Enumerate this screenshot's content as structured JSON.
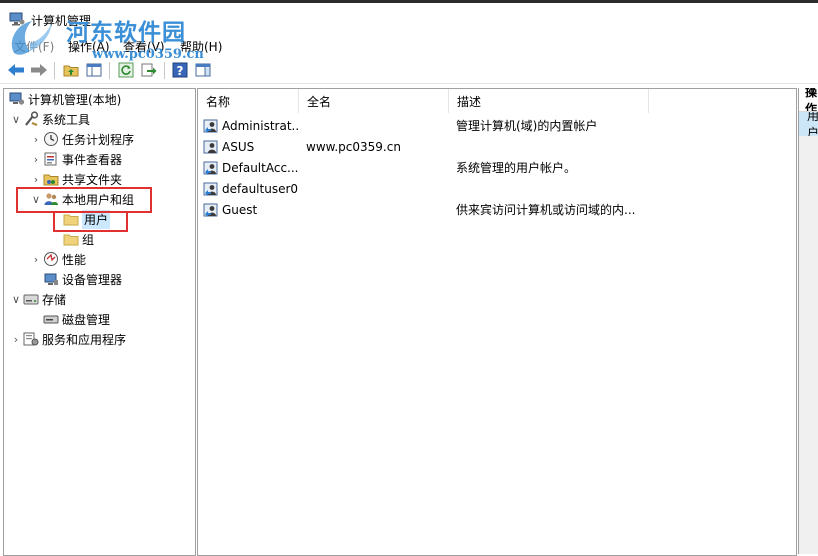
{
  "window": {
    "title": "计算机管理"
  },
  "watermark": {
    "site": "河东软件园",
    "url": "www.pc0359.cn"
  },
  "menu": {
    "file": "文件(F)",
    "action": "操作(A)",
    "view": "查看(V)",
    "help": "帮助(H)"
  },
  "tree": {
    "root": "计算机管理(本地)",
    "system_tools": "系统工具",
    "task_scheduler": "任务计划程序",
    "event_viewer": "事件查看器",
    "shared_folders": "共享文件夹",
    "local_users_groups": "本地用户和组",
    "users": "用户",
    "groups": "组",
    "performance": "性能",
    "device_manager": "设备管理器",
    "storage": "存储",
    "disk_management": "磁盘管理",
    "services_apps": "服务和应用程序"
  },
  "list": {
    "columns": {
      "name": "名称",
      "full_name": "全名",
      "description": "描述"
    },
    "rows": [
      {
        "name": "Administrat...",
        "full_name": "",
        "description": "管理计算机(域)的内置帐户"
      },
      {
        "name": "ASUS",
        "full_name": "www.pc0359.cn",
        "description": ""
      },
      {
        "name": "DefaultAcc...",
        "full_name": "",
        "description": "系统管理的用户帐户。"
      },
      {
        "name": "defaultuser0",
        "full_name": "",
        "description": ""
      },
      {
        "name": "Guest",
        "full_name": "",
        "description": "供来宾访问计算机或访问域的内..."
      }
    ]
  },
  "actions": {
    "header": "操作",
    "item": "用户"
  },
  "colors": {
    "highlight": "#cce8ff",
    "annotation": "#e03030",
    "watermark": "#3a8fd6"
  }
}
